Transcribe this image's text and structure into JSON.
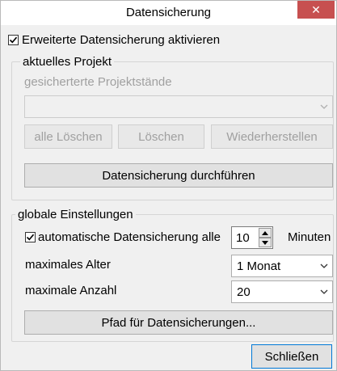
{
  "window": {
    "title": "Datensicherung",
    "close_label": "✕"
  },
  "extended_backup": {
    "checked": true,
    "label": "Erweiterte Datensicherung aktivieren"
  },
  "current_project": {
    "group_title": "aktuelles Projekt",
    "saved_states_label": "gesicherterte Projektstände",
    "saved_states_value": "",
    "delete_all_label": "alle Löschen",
    "delete_label": "Löschen",
    "restore_label": "Wiederherstellen",
    "run_backup_label": "Datensicherung durchführen"
  },
  "global_settings": {
    "group_title": "globale Einstellungen",
    "auto_backup": {
      "checked": true,
      "label": "automatische Datensicherung alle",
      "interval_value": "10",
      "unit_label": "Minuten"
    },
    "max_age_label": "maximales Alter",
    "max_age_value": "1 Monat",
    "max_count_label": "maximale Anzahl",
    "max_count_value": "20",
    "path_button_label": "Pfad für Datensicherungen..."
  },
  "footer": {
    "close_button_label": "Schließen"
  },
  "colors": {
    "close_button_bg": "#c75050",
    "default_button_border": "#0078d7",
    "disabled_text": "#a0a0a0"
  }
}
